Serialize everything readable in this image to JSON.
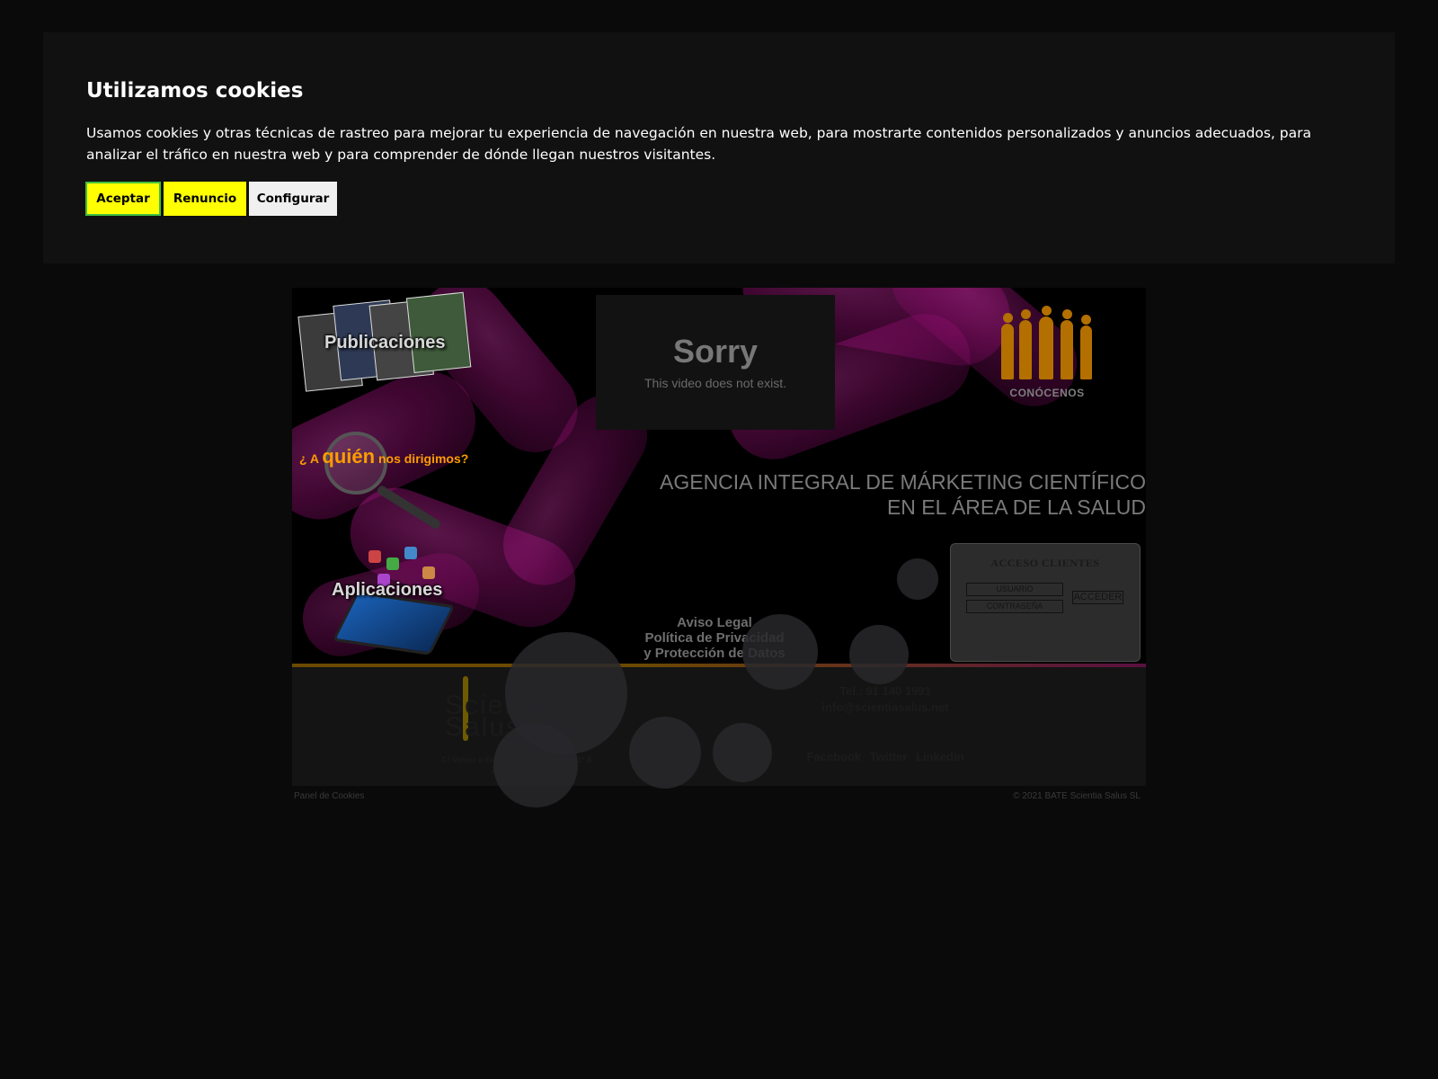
{
  "cookie_banner": {
    "title": "Utilizamos cookies",
    "text": "Usamos cookies y otras técnicas de rastreo para mejorar tu experiencia de navegación en nuestra web, para mostrarte contenidos personalizados y anuncios adecuados, para analizar el tráfico en nuestra web y para comprender de dónde llegan nuestros visitantes.",
    "accept_label": "Aceptar",
    "reject_label": "Renuncio",
    "configure_label": "Configurar",
    "accent_color": "#ffff00",
    "focus_color": "#3fbf3f"
  },
  "hero": {
    "publicaciones_label": "Publicaciones",
    "quien_prefix": "¿ A",
    "quien_highlight": "quién",
    "quien_suffix": "nos dirigimos?",
    "aplicaciones_label": "Aplicaciones",
    "video_title": "Sorry",
    "video_message": "This video does not exist.",
    "conocenos_label": "CONÓCENOS",
    "tagline_line1": "AGENCIA INTEGRAL DE MÁRKETING CIENTÍFICO",
    "tagline_line2": "EN EL ÁREA DE LA SALUD",
    "aviso_legal": "Aviso Legal",
    "politica_line1": "Política de Privacidad",
    "politica_line2": "y Protección de Datos"
  },
  "acceso": {
    "title": "ACCESO CLIENTES",
    "usuario_placeholder": "USUARIO",
    "password_placeholder": "CONTRASEÑA",
    "submit_label": "ACCEDER"
  },
  "footer": {
    "logo_line1": "Scientia",
    "logo_line2": "Salus",
    "address_line1": "C/ Volver a Empezar, nº 4, portal H, 1º A",
    "address_line2": "28018 Madrid",
    "phone": "Tel.: 91 140 1991",
    "email": "info@scientiasalus.net",
    "facebook": "Facebook",
    "twitter": "Twitter",
    "linkedin": "Linkedin",
    "panel_cookies": "Panel de Cookies",
    "copyright": "© 2021 BATE Scientia Salus SL"
  }
}
